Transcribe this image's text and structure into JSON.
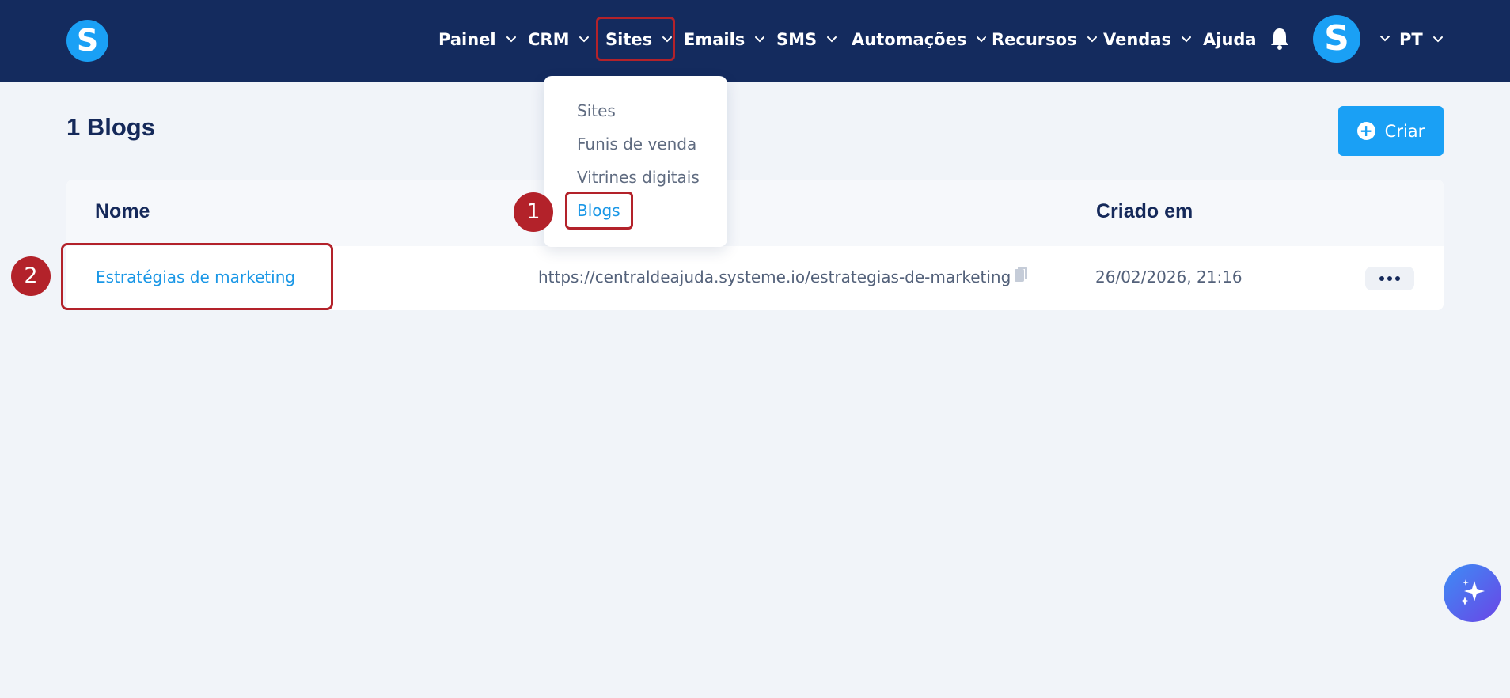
{
  "nav": {
    "items": [
      {
        "label": "Painel",
        "has_chevron": true
      },
      {
        "label": "CRM",
        "has_chevron": true
      },
      {
        "label": "Sites",
        "has_chevron": true
      },
      {
        "label": "Emails",
        "has_chevron": true
      },
      {
        "label": "SMS",
        "has_chevron": true
      },
      {
        "label": "Automações",
        "has_chevron": true
      },
      {
        "label": "Recursos",
        "has_chevron": true
      },
      {
        "label": "Vendas",
        "has_chevron": true
      },
      {
        "label": "Ajuda",
        "has_chevron": false
      }
    ],
    "logo_letter": "S",
    "avatar_letter": "S",
    "language": "PT"
  },
  "dropdown": {
    "items": [
      {
        "label": "Sites",
        "active": false
      },
      {
        "label": "Funis de venda",
        "active": false
      },
      {
        "label": "Vitrines digitais",
        "active": false
      },
      {
        "label": "Blogs",
        "active": true
      }
    ]
  },
  "page": {
    "title": "1 Blogs",
    "create_label": "Criar"
  },
  "table": {
    "columns": {
      "name": "Nome",
      "created": "Criado em"
    },
    "rows": [
      {
        "name": "Estratégias de marketing",
        "url": "https://centraldeajuda.systeme.io/estrategias-de-marketing",
        "created": "26/02/2026, 21:16"
      }
    ]
  },
  "steps": {
    "one": "1",
    "two": "2"
  },
  "colors": {
    "nav_bg": "#142b5e",
    "accent": "#1aa0f5",
    "highlight": "#b3222a",
    "page_bg": "#f1f4f9"
  },
  "icons": [
    "logo-icon",
    "chevron-down-icon",
    "bell-icon",
    "plus-icon",
    "copy-icon",
    "more-icon",
    "sparkle-icon"
  ]
}
